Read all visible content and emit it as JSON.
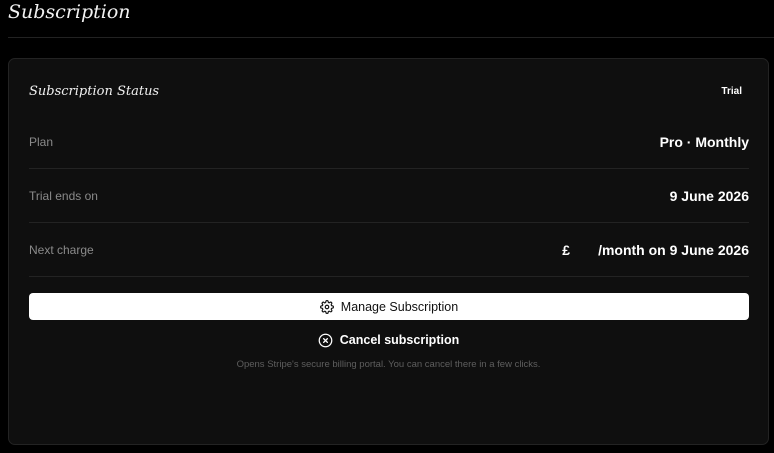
{
  "page": {
    "title": "Subscription"
  },
  "card": {
    "title": "Subscription Status",
    "status_badge": "Trial",
    "rows": [
      {
        "label": "Plan",
        "value": "Pro · Monthly"
      },
      {
        "label": "Trial ends on",
        "value": "9 June 2026"
      },
      {
        "label": "Next charge",
        "currency": "£",
        "value": "/month on 9 June 2026"
      }
    ],
    "manage_button": {
      "label": "Manage Subscription",
      "icon": "gear-icon"
    },
    "cancel_button": {
      "label": "Cancel subscription",
      "icon": "circle-x-icon"
    },
    "helper_text": "Opens Stripe's secure billing portal. You can cancel there in a few clicks."
  }
}
